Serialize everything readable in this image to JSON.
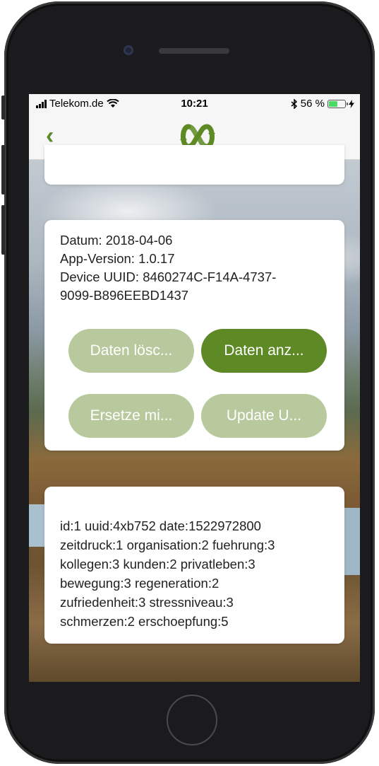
{
  "status_bar": {
    "carrier": "Telekom.de",
    "time": "10:21",
    "battery": "56 %",
    "battery_level": 0.56
  },
  "nav": {
    "back_icon": "chevron-left-icon",
    "logo_icon": "app-logo-icon",
    "accent": "#5e8a25"
  },
  "info": {
    "lines": [
      "Datum: 2018-04-06",
      "App-Version: 1.0.17",
      "Device UUID: 8460274C-F14A-4737-",
      "9099-B896EEBD1437"
    ]
  },
  "buttons": {
    "delete": "Daten lösc...",
    "show": "Daten anz...",
    "replace": "Ersetze mi...",
    "update": "Update U..."
  },
  "data_record": {
    "lines": [
      "id:1 uuid:4xb752 date:1522972800",
      "zeitdruck:1 organisation:2 fuehrung:3",
      "kollegen:3 kunden:2 privatleben:3",
      "bewegung:3 regeneration:2",
      "zufriedenheit:3 stressniveau:3",
      "schmerzen:2 erschoepfung:5"
    ]
  }
}
